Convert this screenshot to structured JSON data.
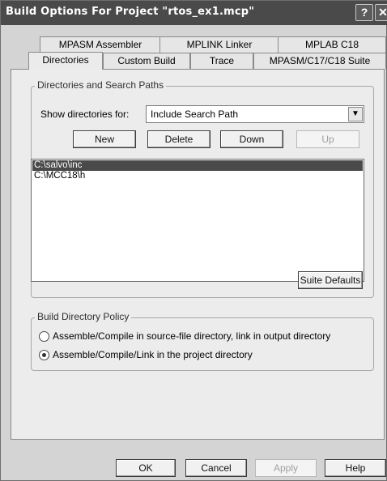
{
  "window": {
    "title": "Build Options For Project \"rtos_ex1.mcp\"",
    "help_glyph": "?",
    "close_glyph": "✕"
  },
  "tabs_back": [
    "MPASM Assembler",
    "MPLINK Linker",
    "MPLAB C18"
  ],
  "tabs_front": [
    "Directories",
    "Custom Build",
    "Trace",
    "MPASM/C17/C18 Suite"
  ],
  "active_tab": "Directories",
  "directories_group": {
    "legend": "Directories and Search Paths",
    "show_label": "Show directories for:",
    "select_value": "Include Search Path",
    "buttons": {
      "new": "New",
      "delete": "Delete",
      "down": "Down",
      "up": "Up"
    },
    "paths": [
      "C:\\salvo\\inc",
      "C:\\MCC18\\h"
    ],
    "suite_defaults": "Suite Defaults"
  },
  "policy_group": {
    "legend": "Build Directory Policy",
    "option1": "Assemble/Compile in source-file directory, link in output directory",
    "option2": "Assemble/Compile/Link in the project directory",
    "selected_option": 2
  },
  "footer": {
    "ok": "OK",
    "cancel": "Cancel",
    "apply": "Apply",
    "help": "Help"
  }
}
